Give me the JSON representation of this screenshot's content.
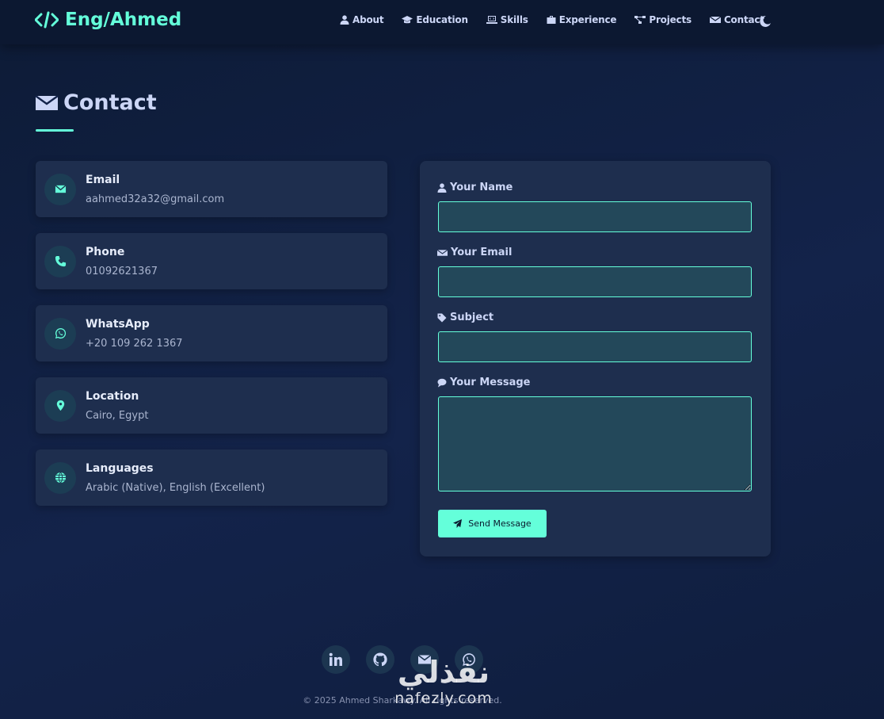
{
  "brand": {
    "logo_icon": "code-icon",
    "name": "Eng/Ahmed"
  },
  "nav": {
    "links": [
      {
        "label": "About",
        "icon": "user-icon"
      },
      {
        "label": "Education",
        "icon": "graduation-cap-icon"
      },
      {
        "label": "Skills",
        "icon": "laptop-code-icon"
      },
      {
        "label": "Experience",
        "icon": "briefcase-icon"
      },
      {
        "label": "Projects",
        "icon": "project-diagram-icon"
      },
      {
        "label": "Contact",
        "icon": "envelope-icon"
      }
    ],
    "theme_toggle_icon": "moon-icon"
  },
  "section": {
    "title": "Contact",
    "icon": "envelope-icon"
  },
  "contact_info": [
    {
      "label": "Email",
      "value": "aahmed32a32@gmail.com",
      "icon": "envelope-icon"
    },
    {
      "label": "Phone",
      "value": "01092621367",
      "icon": "phone-icon"
    },
    {
      "label": "WhatsApp",
      "value": "+20 109 262 1367",
      "icon": "whatsapp-icon"
    },
    {
      "label": "Location",
      "value": "Cairo, Egypt",
      "icon": "map-marker-icon"
    },
    {
      "label": "Languages",
      "value": "Arabic (Native), English (Excellent)",
      "icon": "globe-icon"
    }
  ],
  "form": {
    "name_label": "Your Name",
    "email_label": "Your Email",
    "subject_label": "Subject",
    "message_label": "Your Message",
    "name_value": "",
    "email_value": "",
    "subject_value": "",
    "message_value": "",
    "send_label": "Send Message"
  },
  "footer": {
    "socials": [
      "linkedin-icon",
      "github-icon",
      "envelope-icon",
      "whatsapp-icon"
    ],
    "copyright": "© 2025 Ahmed Sharkawy. All rights reserved."
  },
  "watermark": {
    "arabic": "نفذلي",
    "latin": "nafezly.com"
  },
  "colors": {
    "accent": "#64ffda",
    "background": "#0d1b36",
    "card": "#1e2e4e",
    "text": "#ccd6f6"
  }
}
